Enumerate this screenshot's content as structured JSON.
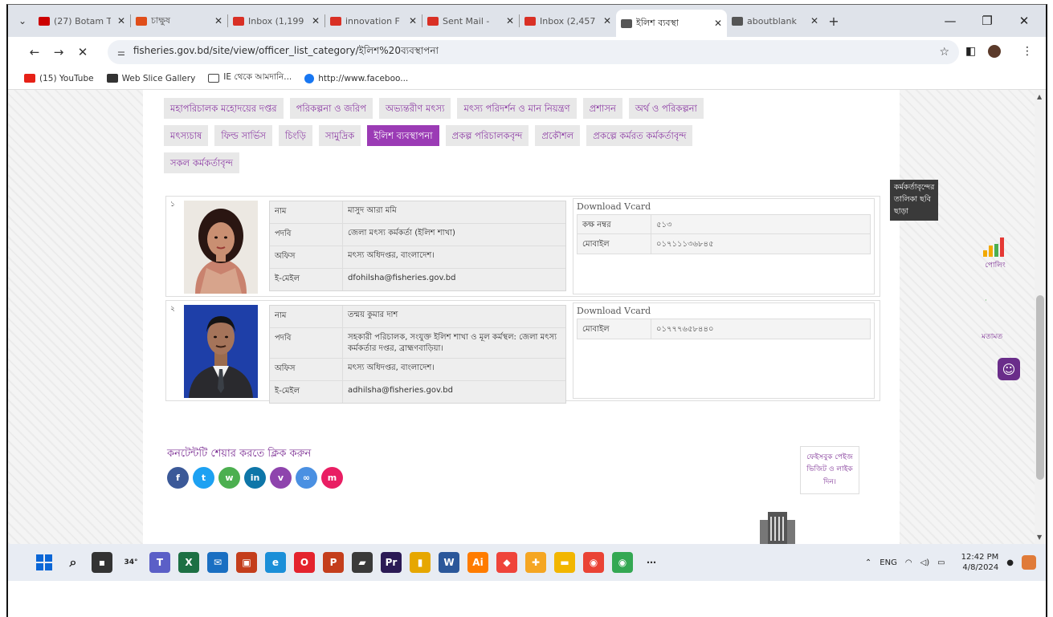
{
  "browser": {
    "tabs": [
      {
        "label": "(27) Botam T",
        "color": "#cc0000",
        "active": false
      },
      {
        "label": "চাক্ষুষ",
        "color": "#e04e1a",
        "active": false
      },
      {
        "label": "Inbox (1,199",
        "color": "#d93025",
        "active": false
      },
      {
        "label": "innovation F",
        "color": "#d93025",
        "active": false
      },
      {
        "label": "Sent Mail -",
        "color": "#d93025",
        "active": false
      },
      {
        "label": "Inbox (2,457",
        "color": "#d93025",
        "active": false
      },
      {
        "label": "ইলিশ ব্যবস্থা",
        "color": "#555555",
        "active": true
      },
      {
        "label": "aboutblank",
        "color": "#555555",
        "active": false
      }
    ],
    "url": "fisheries.gov.bd/site/view/officer_list_category/ইলিশ%20ব্যবস্থাপনা",
    "bookmarks": [
      "(15) YouTube",
      "Web Slice Gallery",
      "IE থেকে আমদানি...",
      "http://www.faceboo..."
    ]
  },
  "menu": {
    "row1": [
      "মহাপরিচালক মহোদয়ের দপ্তর",
      "পরিকল্পনা ও জরিপ",
      "অভ্যন্তরীণ মৎস্য",
      "মৎস্য পরিদর্শন ও মান নিয়ন্ত্রণ",
      "প্রশাসন",
      "অর্থ ও পরিকল্পনা"
    ],
    "row2": [
      "মৎস্যচাষ",
      "ফিল্ড সার্ভিস",
      "চিংড়ি",
      "সামুদ্রিক",
      "ইলিশ ব্যবস্থাপনা",
      "প্রকল্প পরিচালকবৃন্দ",
      "প্রকৌশল",
      "প্রকল্পে কর্মরত কর্মকর্তাবৃন্দ"
    ],
    "row3": [
      "সকল কর্মকর্তাবৃন্দ"
    ],
    "active": "ইলিশ ব্যবস্থাপনা"
  },
  "no_photo_label": "কর্মকর্তাবৃন্দের তালিকা ছবি ছাড়া",
  "labels": {
    "name": "নাম",
    "designation": "পদবি",
    "office": "অফিস",
    "email": "ই-মেইল",
    "download_vcard": "Download Vcard",
    "room": "কক্ষ নম্বর",
    "mobile": "মোবাইল"
  },
  "officers": [
    {
      "num": "১",
      "name": "মাসুদ আরা মমি",
      "designation": "জেলা মৎস্য কর্মকর্তা (ইলিশ শাখা)",
      "office": "মৎস্য অধিদপ্তর, বাংলাদেশ।",
      "email": "dfohilsha@fisheries.gov.bd",
      "room": "৫১৩",
      "mobile": "০১৭১১১৩৬৮৪৫"
    },
    {
      "num": "২",
      "name": "তন্ময় কুমার দাশ",
      "designation": "সহকারী পরিচালক, সংযুক্ত ইলিশ শাখা ও মূল কর্মস্থল: জেলা মৎস্য কর্মকর্তার দপ্তর, ব্রাহ্মণবাড়িয়া।",
      "office": "মৎস্য অধিদপ্তর, বাংলাদেশ।",
      "email": "adhilsha@fisheries.gov.bd",
      "mobile": "০১৭৭৭৬৫৮৪৪০"
    }
  ],
  "share": {
    "label": "কনটেন্টটি শেয়ার করতে ক্লিক করুন",
    "buttons": [
      {
        "name": "facebook",
        "glyph": "f",
        "color": "#3b5998"
      },
      {
        "name": "twitter",
        "glyph": "t",
        "color": "#1da1f2"
      },
      {
        "name": "whatsapp",
        "glyph": "w",
        "color": "#4caf50"
      },
      {
        "name": "linkedin",
        "glyph": "in",
        "color": "#0e76a8"
      },
      {
        "name": "viber",
        "glyph": "v",
        "color": "#8e44ad"
      },
      {
        "name": "copy-link",
        "glyph": "∞",
        "color": "#4a90e2"
      },
      {
        "name": "messenger",
        "glyph": "m",
        "color": "#e91e63"
      }
    ]
  },
  "facebook_box": "ফেইসবুক পেইজ ভিজিট ও লাইক দিন।",
  "sidebar": {
    "poll": "পোলিং",
    "opinion": "মতামত"
  },
  "taskbar": {
    "weather": "34°",
    "apps": [
      {
        "name": "teams",
        "label": "T",
        "color": "#5b5fc7"
      },
      {
        "name": "excel",
        "label": "X",
        "color": "#1d7044"
      },
      {
        "name": "mail",
        "label": "✉",
        "color": "#1a6fc2"
      },
      {
        "name": "photos",
        "label": "▣",
        "color": "#c43e1c"
      },
      {
        "name": "edge",
        "label": "e",
        "color": "#1b8fd8"
      },
      {
        "name": "opera",
        "label": "O",
        "color": "#e4232d"
      },
      {
        "name": "powerpoint",
        "label": "P",
        "color": "#c43e1c"
      },
      {
        "name": "sticky",
        "label": "▰",
        "color": "#3a3a3a"
      },
      {
        "name": "premiere",
        "label": "Pr",
        "color": "#2b1a55"
      },
      {
        "name": "bars",
        "label": "▮",
        "color": "#e6a700"
      },
      {
        "name": "word",
        "label": "W",
        "color": "#2b579a"
      },
      {
        "name": "illustrator",
        "label": "Ai",
        "color": "#ff7c00"
      },
      {
        "name": "anydesk",
        "label": "◆",
        "color": "#ef443b"
      },
      {
        "name": "copilot",
        "label": "✚",
        "color": "#f5a623"
      },
      {
        "name": "explorer",
        "label": "▬",
        "color": "#f2b600"
      },
      {
        "name": "chrome",
        "label": "◉",
        "color": "#ea4335"
      },
      {
        "name": "chrome-profile",
        "label": "◉",
        "color": "#34a853"
      }
    ],
    "lang": "ENG",
    "time": "12:42 PM",
    "date": "4/8/2024"
  }
}
